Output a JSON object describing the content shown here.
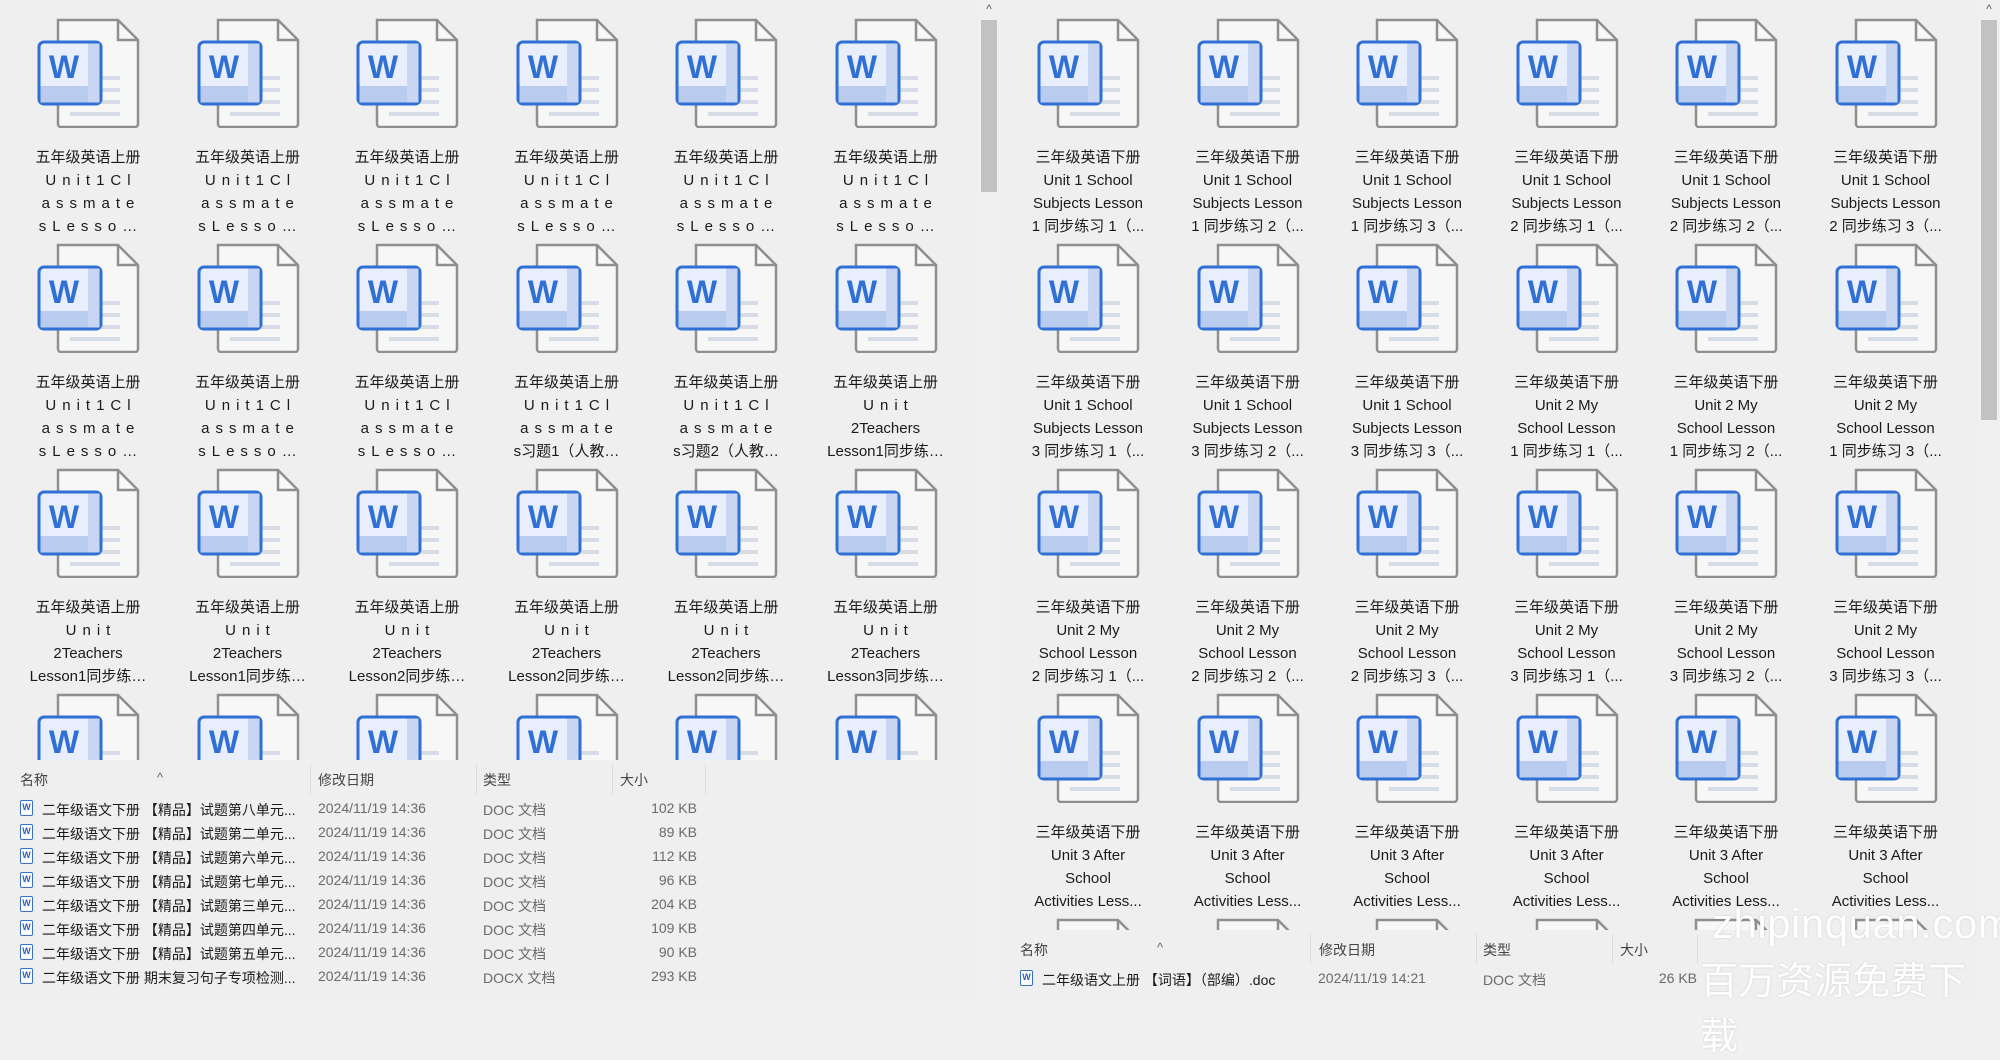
{
  "left_pane": {
    "grid_items": [
      {
        "lines": [
          "五年级英语上册",
          "Unit1Cl",
          "assmate",
          "sLesso…"
        ]
      },
      {
        "lines": [
          "五年级英语上册",
          "Unit1Cl",
          "assmate",
          "sLesso…"
        ]
      },
      {
        "lines": [
          "五年级英语上册",
          "Unit1Cl",
          "assmate",
          "sLesso…"
        ]
      },
      {
        "lines": [
          "五年级英语上册",
          "Unit1Cl",
          "assmate",
          "sLesso…"
        ]
      },
      {
        "lines": [
          "五年级英语上册",
          "Unit1Cl",
          "assmate",
          "sLesso…"
        ]
      },
      {
        "lines": [
          "五年级英语上册",
          "Unit1Cl",
          "assmate",
          "sLesso…"
        ]
      },
      {
        "lines": [
          "五年级英语上册",
          "Unit1Cl",
          "assmate",
          "sLesso…"
        ]
      },
      {
        "lines": [
          "五年级英语上册",
          "Unit1Cl",
          "assmate",
          "sLesso…"
        ]
      },
      {
        "lines": [
          "五年级英语上册",
          "Unit1Cl",
          "assmate",
          "sLesso…"
        ]
      },
      {
        "lines": [
          "五年级英语上册",
          "Unit1Cl",
          "assmate",
          "s习题1（人教…"
        ]
      },
      {
        "lines": [
          "五年级英语上册",
          "Unit1Cl",
          "assmate",
          "s习题2（人教…"
        ]
      },
      {
        "lines": [
          "五年级英语上册",
          "Unit",
          "2Teachers",
          "Lesson1同步练…"
        ]
      },
      {
        "lines": [
          "五年级英语上册",
          "Unit",
          "2Teachers",
          "Lesson1同步练…"
        ]
      },
      {
        "lines": [
          "五年级英语上册",
          "Unit",
          "2Teachers",
          "Lesson1同步练…"
        ]
      },
      {
        "lines": [
          "五年级英语上册",
          "Unit",
          "2Teachers",
          "Lesson2同步练…"
        ]
      },
      {
        "lines": [
          "五年级英语上册",
          "Unit",
          "2Teachers",
          "Lesson2同步练…"
        ]
      },
      {
        "lines": [
          "五年级英语上册",
          "Unit",
          "2Teachers",
          "Lesson2同步练…"
        ]
      },
      {
        "lines": [
          "五年级英语上册",
          "Unit",
          "2Teachers",
          "Lesson3同步练…"
        ]
      },
      {
        "lines": []
      },
      {
        "lines": []
      },
      {
        "lines": []
      },
      {
        "lines": []
      },
      {
        "lines": []
      },
      {
        "lines": []
      }
    ],
    "list": {
      "columns": {
        "name": "名称",
        "date": "修改日期",
        "type": "类型",
        "size": "大小"
      },
      "rows": [
        {
          "name": "二年级语文下册 【精品】试题第八单元...",
          "date": "2024/11/19 14:36",
          "type": "DOC 文档",
          "size": "102 KB"
        },
        {
          "name": "二年级语文下册 【精品】试题第二单元...",
          "date": "2024/11/19 14:36",
          "type": "DOC 文档",
          "size": "89 KB"
        },
        {
          "name": "二年级语文下册 【精品】试题第六单元...",
          "date": "2024/11/19 14:36",
          "type": "DOC 文档",
          "size": "112 KB"
        },
        {
          "name": "二年级语文下册 【精品】试题第七单元...",
          "date": "2024/11/19 14:36",
          "type": "DOC 文档",
          "size": "96 KB"
        },
        {
          "name": "二年级语文下册 【精品】试题第三单元...",
          "date": "2024/11/19 14:36",
          "type": "DOC 文档",
          "size": "204 KB"
        },
        {
          "name": "二年级语文下册 【精品】试题第四单元...",
          "date": "2024/11/19 14:36",
          "type": "DOC 文档",
          "size": "109 KB"
        },
        {
          "name": "二年级语文下册 【精品】试题第五单元...",
          "date": "2024/11/19 14:36",
          "type": "DOC 文档",
          "size": "90 KB"
        },
        {
          "name": "二年级语文下册 期末复习句子专项检测...",
          "date": "2024/11/19 14:36",
          "type": "DOCX 文档",
          "size": "293 KB"
        }
      ]
    }
  },
  "right_pane": {
    "grid_items": [
      {
        "lines": [
          "三年级英语下册",
          "Unit 1 School",
          "Subjects Lesson",
          "1 同步练习 1（..."
        ]
      },
      {
        "lines": [
          "三年级英语下册",
          "Unit 1 School",
          "Subjects Lesson",
          "1 同步练习 2（..."
        ]
      },
      {
        "lines": [
          "三年级英语下册",
          "Unit 1 School",
          "Subjects Lesson",
          "1 同步练习 3（..."
        ]
      },
      {
        "lines": [
          "三年级英语下册",
          "Unit 1 School",
          "Subjects Lesson",
          "2 同步练习 1（..."
        ]
      },
      {
        "lines": [
          "三年级英语下册",
          "Unit 1 School",
          "Subjects Lesson",
          "2 同步练习 2（..."
        ]
      },
      {
        "lines": [
          "三年级英语下册",
          "Unit 1 School",
          "Subjects Lesson",
          "2 同步练习 3（..."
        ]
      },
      {
        "lines": [
          "三年级英语下册",
          "Unit 1 School",
          "Subjects Lesson",
          "3 同步练习 1（..."
        ]
      },
      {
        "lines": [
          "三年级英语下册",
          "Unit 1 School",
          "Subjects Lesson",
          "3 同步练习 2（..."
        ]
      },
      {
        "lines": [
          "三年级英语下册",
          "Unit 1 School",
          "Subjects Lesson",
          "3 同步练习 3（..."
        ]
      },
      {
        "lines": [
          "三年级英语下册",
          "Unit 2 My",
          "School Lesson",
          "1 同步练习 1（..."
        ]
      },
      {
        "lines": [
          "三年级英语下册",
          "Unit 2 My",
          "School Lesson",
          "1 同步练习 2（..."
        ]
      },
      {
        "lines": [
          "三年级英语下册",
          "Unit 2 My",
          "School Lesson",
          "1 同步练习 3（..."
        ]
      },
      {
        "lines": [
          "三年级英语下册",
          "Unit 2 My",
          "School Lesson",
          "2 同步练习 1（..."
        ]
      },
      {
        "lines": [
          "三年级英语下册",
          "Unit 2 My",
          "School Lesson",
          "2 同步练习 2（..."
        ]
      },
      {
        "lines": [
          "三年级英语下册",
          "Unit 2 My",
          "School Lesson",
          "2 同步练习 3（..."
        ]
      },
      {
        "lines": [
          "三年级英语下册",
          "Unit 2 My",
          "School Lesson",
          "3 同步练习 1（..."
        ]
      },
      {
        "lines": [
          "三年级英语下册",
          "Unit 2 My",
          "School Lesson",
          "3 同步练习 2（..."
        ]
      },
      {
        "lines": [
          "三年级英语下册",
          "Unit 2 My",
          "School Lesson",
          "3 同步练习 3（..."
        ]
      },
      {
        "lines": [
          "三年级英语下册",
          "Unit 3 After",
          "School",
          "Activities Less..."
        ]
      },
      {
        "lines": [
          "三年级英语下册",
          "Unit 3 After",
          "School",
          "Activities Less..."
        ]
      },
      {
        "lines": [
          "三年级英语下册",
          "Unit 3 After",
          "School",
          "Activities Less..."
        ]
      },
      {
        "lines": [
          "三年级英语下册",
          "Unit 3 After",
          "School",
          "Activities Less..."
        ]
      },
      {
        "lines": [
          "三年级英语下册",
          "Unit 3 After",
          "School",
          "Activities Less..."
        ]
      },
      {
        "lines": [
          "三年级英语下册",
          "Unit 3 After",
          "School",
          "Activities Less..."
        ]
      },
      {
        "lines": []
      },
      {
        "lines": []
      },
      {
        "lines": []
      },
      {
        "lines": []
      },
      {
        "lines": []
      },
      {
        "lines": []
      }
    ],
    "list": {
      "columns": {
        "name": "名称",
        "date": "修改日期",
        "type": "类型",
        "size": "大小"
      },
      "rows": [
        {
          "name": "二年级语文上册 【词语】（部编）.doc",
          "date": "2024/11/19 14:21",
          "type": "DOC 文档",
          "size": "26 KB"
        }
      ]
    }
  },
  "watermark": {
    "domain": "zhipinquan.com",
    "slogan": "百万资源免费下载"
  },
  "icons": {
    "file": "word-doc-icon",
    "scroll_up": "chevron-up-icon",
    "sort": "sort-ascending-icon"
  },
  "colors": {
    "word_blue": "#2f6fd6",
    "background": "#efefef"
  }
}
